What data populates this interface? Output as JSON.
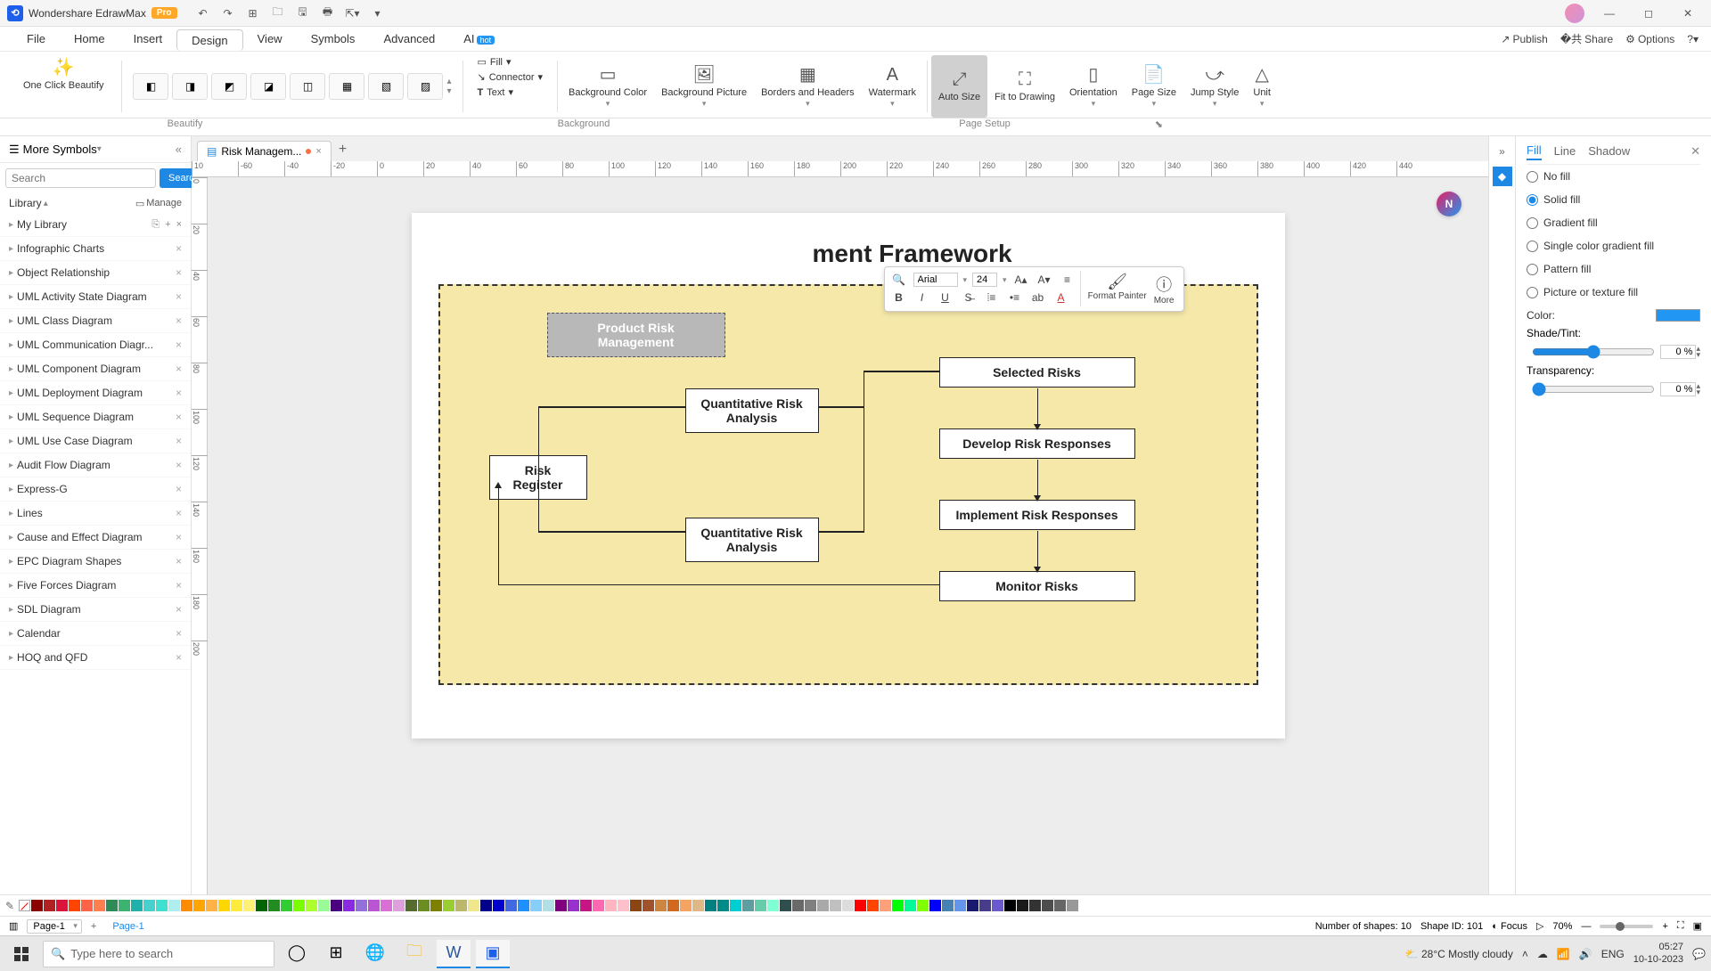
{
  "app": {
    "title": "Wondershare EdrawMax",
    "pro": "Pro"
  },
  "menu": {
    "items": [
      "File",
      "Home",
      "Insert",
      "Design",
      "View",
      "Symbols",
      "Advanced",
      "AI"
    ],
    "active": "Design",
    "right": {
      "publish": "Publish",
      "share": "Share",
      "options": "Options"
    }
  },
  "ribbon": {
    "one_click": "One Click Beautify",
    "fill_label": "Fill",
    "connector_label": "Connector",
    "text_label": "Text",
    "bg_color": "Background Color",
    "bg_picture": "Background Picture",
    "borders": "Borders and Headers",
    "watermark": "Watermark",
    "auto_size": "Auto Size",
    "fit": "Fit to Drawing",
    "orientation": "Orientation",
    "page_size": "Page Size",
    "jump_style": "Jump Style",
    "unit": "Unit",
    "group_beautify": "Beautify",
    "group_background": "Background",
    "group_pagesetup": "Page Setup"
  },
  "doc_tab": {
    "name": "Risk Managem...",
    "page_tab": "Page-1",
    "page_sel": "Page-1"
  },
  "left": {
    "title": "More Symbols",
    "search_placeholder": "Search",
    "search_btn": "Search",
    "library": "Library",
    "manage": "Manage",
    "mylib": "My Library",
    "items": [
      "Infographic Charts",
      "Object Relationship",
      "UML Activity State Diagram",
      "UML Class Diagram",
      "UML Communication Diagr...",
      "UML Component Diagram",
      "UML Deployment Diagram",
      "UML Sequence Diagram",
      "UML Use Case Diagram",
      "Audit Flow Diagram",
      "Express-G",
      "Lines",
      "Cause and Effect Diagram",
      "EPC Diagram Shapes",
      "Five Forces Diagram",
      "SDL Diagram",
      "Calendar",
      "HOQ and QFD"
    ]
  },
  "diagram": {
    "title_suffix": "ment Framework",
    "n_product": "Product Risk Management",
    "n_register": "Risk Register",
    "n_qra1": "Quantitative Risk Analysis",
    "n_qra2": "Quantitative Risk Analysis",
    "n_selected": "Selected Risks",
    "n_develop": "Develop Risk Responses",
    "n_implement": "Implement Risk Responses",
    "n_monitor": "Monitor Risks"
  },
  "float": {
    "font": "Arial",
    "size": "24",
    "format_painter": "Format Painter",
    "more": "More"
  },
  "right": {
    "tabs": {
      "fill": "Fill",
      "line": "Line",
      "shadow": "Shadow"
    },
    "no_fill": "No fill",
    "solid": "Solid fill",
    "gradient": "Gradient fill",
    "single_grad": "Single color gradient fill",
    "pattern": "Pattern fill",
    "picture": "Picture or texture fill",
    "color": "Color:",
    "shade": "Shade/Tint:",
    "transparency": "Transparency:",
    "pct": "0 %"
  },
  "status": {
    "shapes_label": "Number of shapes:",
    "shapes": "10",
    "shapeid_label": "Shape ID:",
    "shapeid": "101",
    "focus": "Focus",
    "zoom": "70%"
  },
  "ruler_h": [
    "10",
    "-60",
    "-40",
    "-20",
    "0",
    "20",
    "40",
    "60",
    "80",
    "100",
    "120",
    "140",
    "160",
    "180",
    "200",
    "220",
    "240",
    "260",
    "280",
    "300",
    "320",
    "340",
    "360",
    "380",
    "400",
    "420",
    "440"
  ],
  "ruler_v": [
    "0",
    "20",
    "40",
    "60",
    "80",
    "100",
    "120",
    "140",
    "160",
    "180",
    "200"
  ],
  "taskbar": {
    "search": "Type here to search",
    "weather": "28°C  Mostly cloudy",
    "time": "05:27",
    "date": "10-10-2023"
  },
  "palette": [
    "#8b0000",
    "#b22222",
    "#dc143c",
    "#ff4500",
    "#ff6347",
    "#ff7f50",
    "#2e8b57",
    "#3cb371",
    "#20b2aa",
    "#48d1cc",
    "#40e0d0",
    "#afeeee",
    "#ff8c00",
    "#ffa500",
    "#ffb347",
    "#ffd700",
    "#ffeb3b",
    "#fff176",
    "#006400",
    "#228b22",
    "#32cd32",
    "#7cfc00",
    "#adff2f",
    "#98fb98",
    "#4b0082",
    "#8a2be2",
    "#9370db",
    "#ba55d3",
    "#da70d6",
    "#dda0dd",
    "#556b2f",
    "#6b8e23",
    "#808000",
    "#9acd32",
    "#bdb76b",
    "#f0e68c",
    "#00008b",
    "#0000cd",
    "#4169e1",
    "#1e90ff",
    "#87cefa",
    "#b0e0e6",
    "#800080",
    "#9932cc",
    "#c71585",
    "#ff69b4",
    "#ffb6c1",
    "#ffc0cb",
    "#8b4513",
    "#a0522d",
    "#cd853f",
    "#d2691e",
    "#f4a460",
    "#deb887",
    "#008080",
    "#008b8b",
    "#00ced1",
    "#5f9ea0",
    "#66cdaa",
    "#7fffd4",
    "#2f4f4f",
    "#696969",
    "#808080",
    "#a9a9a9",
    "#c0c0c0",
    "#dcdcdc",
    "#ff0000",
    "#ff4500",
    "#ffa07a",
    "#00ff00",
    "#00fa9a",
    "#7fff00",
    "#0000ff",
    "#4682b4",
    "#6495ed",
    "#191970",
    "#483d8b",
    "#6a5acd",
    "#000000",
    "#1a1a1a",
    "#333333",
    "#4d4d4d",
    "#666666",
    "#999999"
  ]
}
